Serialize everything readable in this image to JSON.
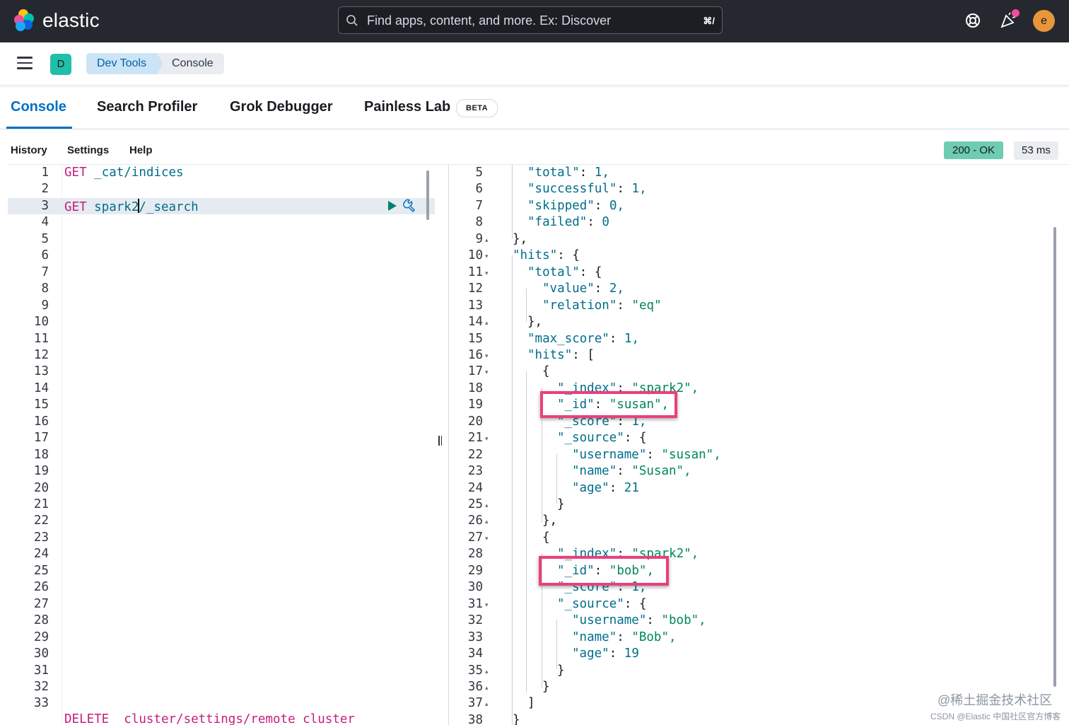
{
  "header": {
    "brand": "elastic",
    "search_placeholder": "Find apps, content, and more. Ex: Discover",
    "search_shortcut": "⌘/",
    "avatar_initial": "e",
    "colors": {
      "bg": "#25282f",
      "avatar": "#e7963a",
      "notify_dot": "#f04e98"
    }
  },
  "breadcrumbs": {
    "space_initial": "D",
    "items": [
      "Dev Tools",
      "Console"
    ]
  },
  "tabs": [
    {
      "label": "Console",
      "active": true
    },
    {
      "label": "Search Profiler",
      "active": false
    },
    {
      "label": "Grok Debugger",
      "active": false
    },
    {
      "label": "Painless Lab",
      "active": false,
      "badge": "BETA"
    }
  ],
  "toolbar": {
    "links": [
      "History",
      "Settings",
      "Help"
    ],
    "status": "200 - OK",
    "duration": "53 ms"
  },
  "editor": {
    "line_numbers": [
      "1",
      "2",
      "3",
      "4",
      "5",
      "6",
      "7",
      "8",
      "9",
      "10",
      "11",
      "12",
      "13",
      "14",
      "15",
      "16",
      "17",
      "18",
      "19",
      "20",
      "21",
      "22",
      "23",
      "24",
      "25",
      "26",
      "27",
      "28",
      "29",
      "30",
      "31",
      "32",
      "33"
    ],
    "requests": [
      {
        "method": "GET",
        "path": "_cat/indices"
      },
      {
        "method": "GET",
        "path_before_cursor": "spark2",
        "path_after_cursor": "/_search"
      }
    ],
    "partial_last_line": "DELETE _cluster/settings/remote_cluster"
  },
  "output": {
    "lines": [
      {
        "n": "5",
        "k": "total",
        "v": "1,",
        "t": "n"
      },
      {
        "n": "6",
        "k": "successful",
        "v": "1,",
        "t": "n"
      },
      {
        "n": "7",
        "k": "skipped",
        "v": "0,",
        "t": "n"
      },
      {
        "n": "8",
        "k": "failed",
        "v": "0",
        "t": "n"
      },
      {
        "n": "9",
        "text": "},"
      },
      {
        "n": "10",
        "k": "hits",
        "v": "{",
        "t": "p"
      },
      {
        "n": "11",
        "k": "total",
        "v": "{",
        "t": "p"
      },
      {
        "n": "12",
        "k": "value",
        "v": "2,",
        "t": "n"
      },
      {
        "n": "13",
        "k": "relation",
        "v": "\"eq\"",
        "t": "s"
      },
      {
        "n": "14",
        "text": "},"
      },
      {
        "n": "15",
        "k": "max_score",
        "v": "1,",
        "t": "n"
      },
      {
        "n": "16",
        "k": "hits",
        "v": "[",
        "t": "p"
      },
      {
        "n": "17",
        "text": "{"
      },
      {
        "n": "18",
        "k": "_index",
        "v": "\"spark2\",",
        "t": "s"
      },
      {
        "n": "19",
        "k": "_id",
        "v": "\"susan\",",
        "t": "s"
      },
      {
        "n": "20",
        "k": "_score",
        "v": "1,",
        "t": "n"
      },
      {
        "n": "21",
        "k": "_source",
        "v": "{",
        "t": "p"
      },
      {
        "n": "22",
        "k": "username",
        "v": "\"susan\",",
        "t": "s"
      },
      {
        "n": "23",
        "k": "name",
        "v": "\"Susan\",",
        "t": "s"
      },
      {
        "n": "24",
        "k": "age",
        "v": "21",
        "t": "n"
      },
      {
        "n": "25",
        "text": "}"
      },
      {
        "n": "26",
        "text": "},"
      },
      {
        "n": "27",
        "text": "{"
      },
      {
        "n": "28",
        "k": "_index",
        "v": "\"spark2\",",
        "t": "s"
      },
      {
        "n": "29",
        "k": "_id",
        "v": "\"bob\",",
        "t": "s"
      },
      {
        "n": "30",
        "k": "_score",
        "v": "1,",
        "t": "n"
      },
      {
        "n": "31",
        "k": "_source",
        "v": "{",
        "t": "p"
      },
      {
        "n": "32",
        "k": "username",
        "v": "\"bob\",",
        "t": "s"
      },
      {
        "n": "33",
        "k": "name",
        "v": "\"Bob\",",
        "t": "s"
      },
      {
        "n": "34",
        "k": "age",
        "v": "19",
        "t": "n"
      },
      {
        "n": "35",
        "text": "}"
      },
      {
        "n": "36",
        "text": "}"
      },
      {
        "n": "37",
        "text": "]"
      },
      {
        "n": "38",
        "text": "}"
      }
    ]
  },
  "watermark": {
    "line1": "@稀土掘金技术社区",
    "line2": "CSDN @Elastic 中国社区官方博客"
  }
}
